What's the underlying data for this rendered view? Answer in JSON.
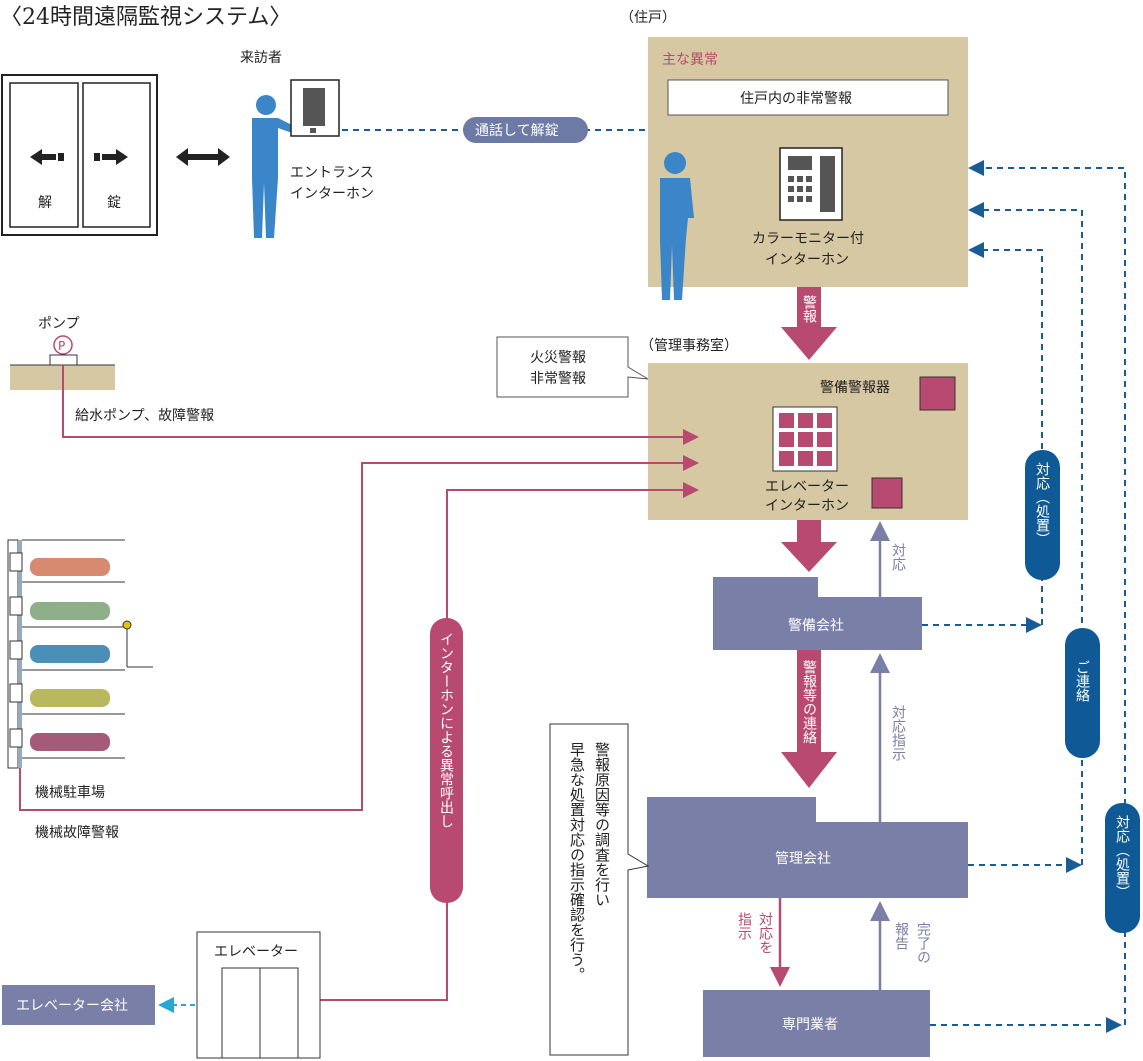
{
  "title": "〈24時間遠隔監視システム〉",
  "entrance": {
    "door_left": "解",
    "door_right": "錠",
    "visitor": "来訪者",
    "intercom_line1": "エントランス",
    "intercom_line2": "インターホン",
    "call_pill": "通話して解錠"
  },
  "dwelling": {
    "label": "（住戸）",
    "main_abnormal": "主な異常",
    "alarm_box": "住戸内の非常警報",
    "monitor_line1": "カラーモニター付",
    "monitor_line2": "インターホン",
    "arrow_label": "警報"
  },
  "office": {
    "label": "（管理事務室）",
    "callout_line1": "火災警報",
    "callout_line2": "非常警報",
    "security_alarm": "警備警報器",
    "elevator_line1": "エレベーター",
    "elevator_line2": "インターホン"
  },
  "pump": {
    "label": "ポンプ",
    "symbol": "P",
    "alarm": "給水ポンプ、故障警報"
  },
  "parking": {
    "label": "機械駐車場",
    "alarm": "機械故障警報"
  },
  "elevator": {
    "label": "エレベーター",
    "company": "エレベーター会社",
    "call_pill": "インターホンによる異常呼出し"
  },
  "security_company": {
    "label": "警備会社",
    "response": "対応"
  },
  "management_company": {
    "label": "管理会社",
    "instruction": "対応指示",
    "arrow_label": "警報等の連絡"
  },
  "specialist": {
    "label": "専門業者",
    "instruct_line1": "対応を",
    "instruct_line2": "指示",
    "report_line1": "完了の",
    "report_line2": "報告"
  },
  "left_callout": {
    "line1": "警報原因等の調査を行い",
    "line2": "早急な処置対応の指示確認を行う。"
  },
  "right_pills": {
    "security_response": "対応（処置）",
    "contact": "ご連絡",
    "specialist_response": "対応（処置）"
  },
  "colors": {
    "tan": "#d6c8a2",
    "box": "#7a7fa8",
    "magenta": "#b84a72",
    "dashed": "#1a5c96",
    "pill": "#0f5a96",
    "person": "#3a86c8"
  }
}
